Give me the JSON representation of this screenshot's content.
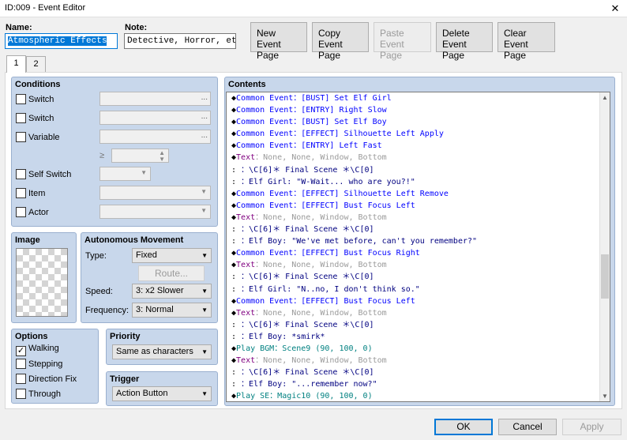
{
  "window": {
    "title": "ID:009 - Event Editor",
    "close_glyph": "✕"
  },
  "name": {
    "label": "Name:",
    "value": "Atmospheric Effects"
  },
  "note": {
    "label": "Note:",
    "value": "Detective, Horror, etc."
  },
  "toolbar": {
    "new_1": "New",
    "new_2": "Event Page",
    "copy_1": "Copy",
    "copy_2": "Event Page",
    "paste_1": "Paste",
    "paste_2": "Event Page",
    "delete_1": "Delete",
    "delete_2": "Event Page",
    "clear_1": "Clear",
    "clear_2": "Event Page"
  },
  "tabs": [
    "1",
    "2"
  ],
  "conditions": {
    "title": "Conditions",
    "switch1": "Switch",
    "switch2": "Switch",
    "variable": "Variable",
    "gte": "≥",
    "self_switch": "Self Switch",
    "item": "Item",
    "actor": "Actor",
    "dots": "..."
  },
  "image": {
    "title": "Image"
  },
  "autonomous": {
    "title": "Autonomous Movement",
    "type_label": "Type:",
    "type_value": "Fixed",
    "route": "Route...",
    "speed_label": "Speed:",
    "speed_value": "3: x2 Slower",
    "freq_label": "Frequency:",
    "freq_value": "3: Normal"
  },
  "options": {
    "title": "Options",
    "walking": "Walking",
    "walking_checked": "✓",
    "stepping": "Stepping",
    "direction_fix": "Direction Fix",
    "through": "Through"
  },
  "priority": {
    "title": "Priority",
    "value": "Same as characters"
  },
  "trigger": {
    "title": "Trigger",
    "value": "Action Button"
  },
  "contents": {
    "title": "Contents",
    "commands": [
      {
        "type": "ce",
        "text": "Common Event：[BUST] Set Elf Girl"
      },
      {
        "type": "ce",
        "text": "Common Event：[ENTRY] Right Slow"
      },
      {
        "type": "ce",
        "text": "Common Event：[BUST] Set Elf Boy"
      },
      {
        "type": "ce",
        "text": "Common Event：[EFFECT] Silhouette Left Apply"
      },
      {
        "type": "ce",
        "text": "Common Event：[ENTRY] Left Fast"
      },
      {
        "type": "tx",
        "text": "Text",
        "params": "：None, None, Window, Bottom"
      },
      {
        "type": "msg",
        "text": "：\\C[6]＊ Final Scene ＊\\C[0]"
      },
      {
        "type": "msg",
        "text": "：Elf Girl: \"W-Wait... who are you?!\""
      },
      {
        "type": "ce",
        "text": "Common Event：[EFFECT] Silhouette Left Remove"
      },
      {
        "type": "ce",
        "text": "Common Event：[EFFECT] Bust Focus Left"
      },
      {
        "type": "tx",
        "text": "Text",
        "params": "：None, None, Window, Bottom"
      },
      {
        "type": "msg",
        "text": "：\\C[6]＊ Final Scene ＊\\C[0]"
      },
      {
        "type": "msg",
        "text": "：Elf Boy: \"We've met before, can't you remember?\""
      },
      {
        "type": "ce",
        "text": "Common Event：[EFFECT] Bust Focus Right"
      },
      {
        "type": "tx",
        "text": "Text",
        "params": "：None, None, Window, Bottom"
      },
      {
        "type": "msg",
        "text": "：\\C[6]＊ Final Scene ＊\\C[0]"
      },
      {
        "type": "msg",
        "text": "：Elf Girl: \"N..no, I don't think so.\""
      },
      {
        "type": "ce",
        "text": "Common Event：[EFFECT] Bust Focus Left"
      },
      {
        "type": "tx",
        "text": "Text",
        "params": "：None, None, Window, Bottom"
      },
      {
        "type": "msg",
        "text": "：\\C[6]＊ Final Scene ＊\\C[0]"
      },
      {
        "type": "msg",
        "text": "：Elf Boy: *smirk*"
      },
      {
        "type": "bgm",
        "text": "Play BGM：Scene9 (90, 100, 0)"
      },
      {
        "type": "tx",
        "text": "Text",
        "params": "：None, None, Window, Bottom"
      },
      {
        "type": "msg",
        "text": "：\\C[6]＊ Final Scene ＊\\C[0]"
      },
      {
        "type": "msg",
        "text": "：Elf Boy: \"...remember now?\""
      },
      {
        "type": "bgm",
        "text": "Play SE：Magic10 (90, 100, 0)"
      }
    ]
  },
  "footer": {
    "ok": "OK",
    "cancel": "Cancel",
    "apply": "Apply"
  }
}
